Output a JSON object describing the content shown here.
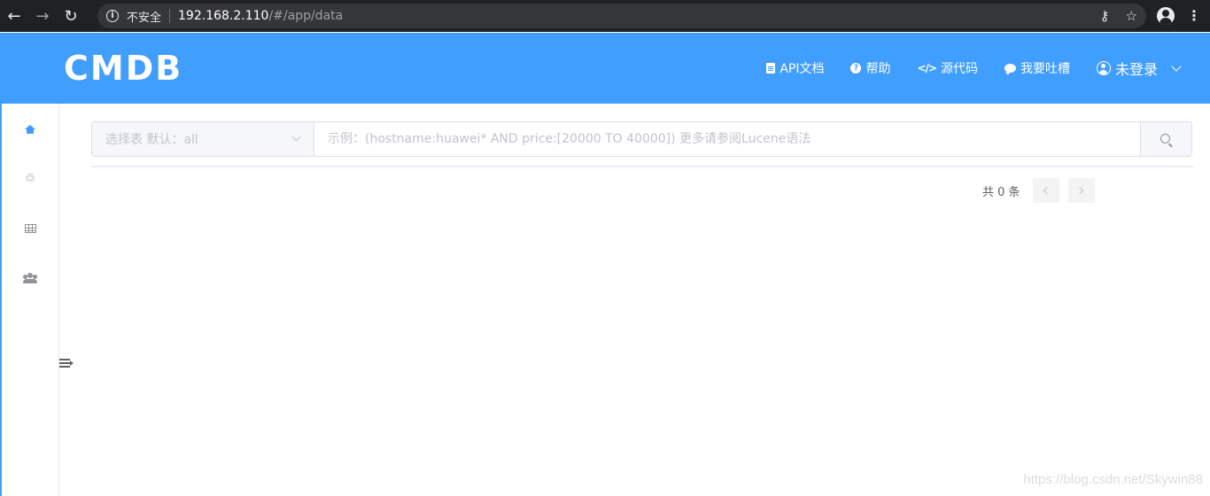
{
  "browser": {
    "security_label": "不安全",
    "url_host": "192.168.2.110",
    "url_path": "/#/app/data"
  },
  "header": {
    "logo": "CMDB",
    "nav": {
      "api_docs": "API文档",
      "help": "帮助",
      "source_code": "源代码",
      "feedback": "我要吐槽",
      "user": "未登录"
    }
  },
  "sidebar": {
    "items": [
      {
        "icon": "home-icon",
        "active": true
      },
      {
        "icon": "recycle-icon",
        "active": false
      },
      {
        "icon": "table-icon",
        "active": false
      },
      {
        "icon": "users-icon",
        "active": false
      }
    ]
  },
  "search": {
    "table_select_placeholder": "选择表 默认：all",
    "query_placeholder": "示例：(hostname:huawei* AND price:[20000 TO 40000]) 更多请参阅Lucene语法"
  },
  "pagination": {
    "total_text": "共 0 条"
  },
  "watermark": "https://blog.csdn.net/Skywin88",
  "colors": {
    "primary": "#409eff",
    "chrome_bg": "#202124"
  }
}
